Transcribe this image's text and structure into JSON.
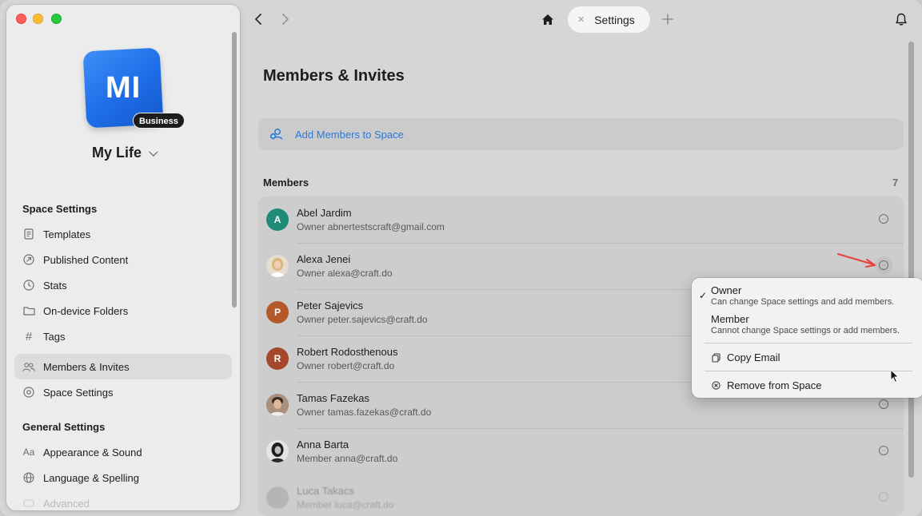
{
  "window": {
    "space": {
      "logo_text": "MI",
      "badge": "Business",
      "name": "My Life"
    },
    "sidebar": {
      "space_settings_header": "Space Settings",
      "space_items": [
        {
          "label": "Templates",
          "icon": "templates-icon"
        },
        {
          "label": "Published Content",
          "icon": "published-icon"
        },
        {
          "label": "Stats",
          "icon": "stats-icon"
        },
        {
          "label": "On-device Folders",
          "icon": "folder-icon"
        },
        {
          "label": "Tags",
          "icon": "hash-icon"
        },
        {
          "label": "Members & Invites",
          "icon": "people-icon",
          "active": true
        },
        {
          "label": "Space Settings",
          "icon": "gear-icon"
        }
      ],
      "general_settings_header": "General Settings",
      "general_items": [
        {
          "label": "Appearance & Sound",
          "icon": "text-icon"
        },
        {
          "label": "Language & Spelling",
          "icon": "globe-icon"
        },
        {
          "label": "Advanced",
          "icon": "advanced-icon"
        }
      ]
    },
    "topbar": {
      "tab_label": "Settings"
    },
    "main": {
      "title": "Members & Invites",
      "add_members_label": "Add Members to Space",
      "members_header": "Members",
      "members_count": "7",
      "members": [
        {
          "name": "Abel Jardim",
          "role": "Owner",
          "email": "abnertestscraft@gmail.com",
          "initial": "A",
          "color": "#1f8a78"
        },
        {
          "name": "Alexa Jenei",
          "role": "Owner",
          "email": "alexa@craft.do",
          "initial": "",
          "color": "#d9c7b0"
        },
        {
          "name": "Peter Sajevics",
          "role": "Owner",
          "email": "peter.sajevics@craft.do",
          "initial": "P",
          "color": "#b5592a"
        },
        {
          "name": "Robert Rodosthenous",
          "role": "Owner",
          "email": "robert@craft.do",
          "initial": "R",
          "color": "#a4472b"
        },
        {
          "name": "Tamas Fazekas",
          "role": "Owner",
          "email": "tamas.fazekas@craft.do",
          "initial": "",
          "color": "#b98a6a"
        },
        {
          "name": "Anna Barta",
          "role": "Member",
          "email": "anna@craft.do",
          "initial": "",
          "color": "#3a3a3a"
        },
        {
          "name": "Luca Takacs",
          "role": "Member",
          "email": "luca@craft.do",
          "initial": "",
          "color": "#8a8a8a"
        }
      ]
    },
    "menu": {
      "owner_label": "Owner",
      "owner_desc": "Can change Space settings and add members.",
      "member_label": "Member",
      "member_desc": "Cannot change Space settings or add members.",
      "copy_email": "Copy Email",
      "remove": "Remove from Space"
    },
    "colors": {
      "accent": "#2a78d6",
      "annotation_arrow": "#e8413a"
    }
  }
}
